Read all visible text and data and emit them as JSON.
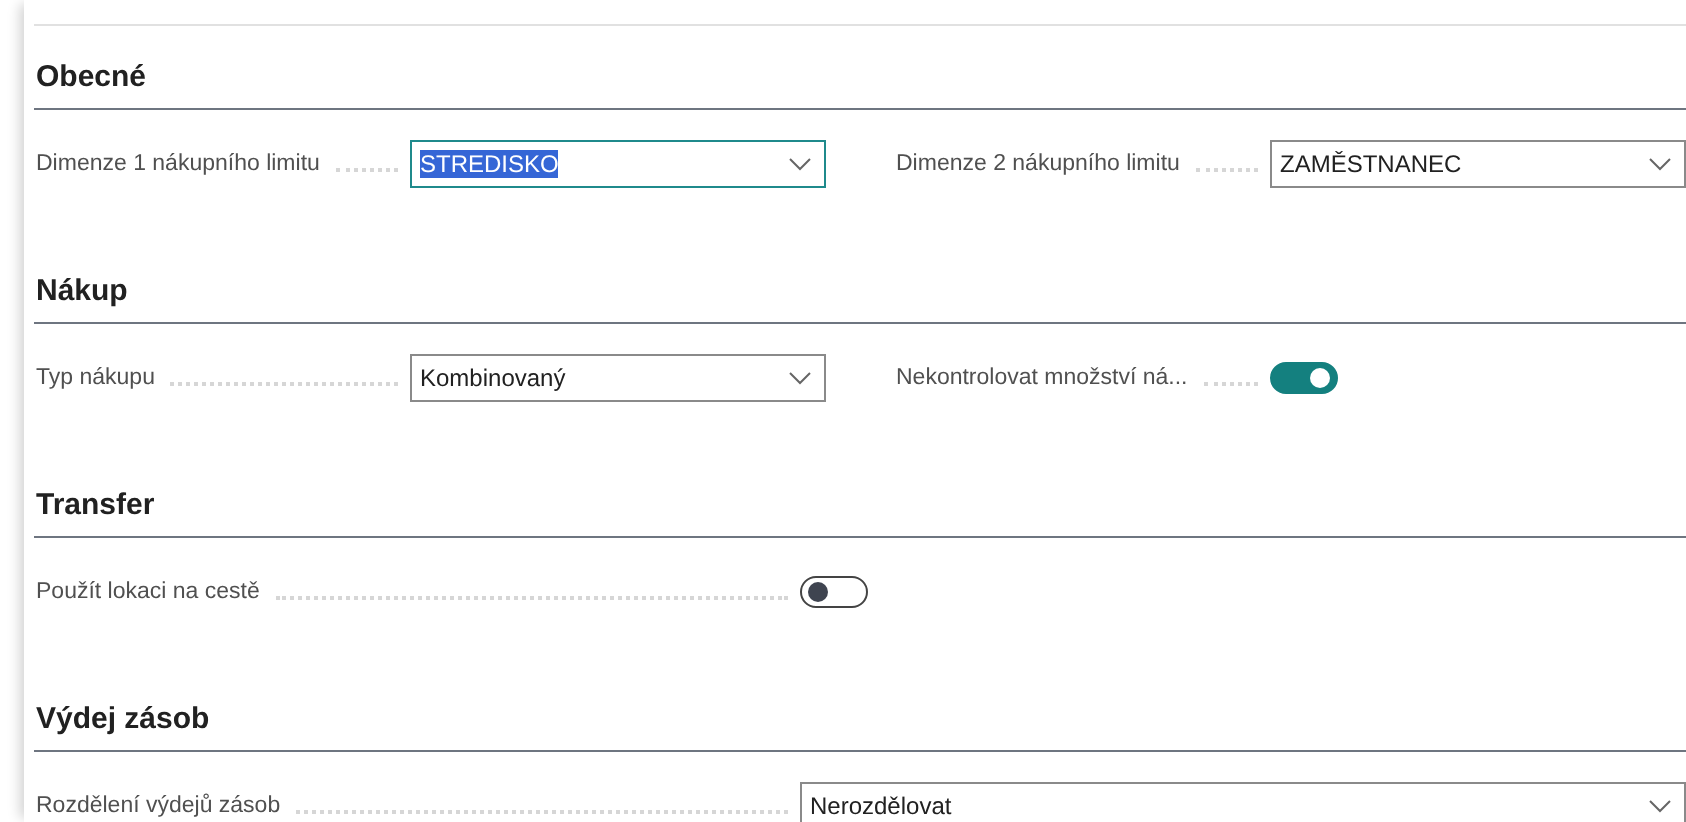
{
  "sections": [
    {
      "title": "Obecné",
      "fields": [
        {
          "kind": "select",
          "label": "Dimenze 1 nákupního limitu",
          "value": "STREDISKO",
          "focused": true
        },
        {
          "kind": "select",
          "label": "Dimenze 2 nákupního limitu",
          "value": "ZAMĚSTNANEC",
          "focused": false
        }
      ]
    },
    {
      "title": "Nákup",
      "fields": [
        {
          "kind": "select",
          "label": "Typ nákupu",
          "value": "Kombinovaný",
          "focused": false
        },
        {
          "kind": "toggle",
          "label": "Nekontrolovat množství ná...",
          "on": true
        }
      ]
    },
    {
      "title": "Transfer",
      "fields": [
        {
          "kind": "toggle",
          "label": "Použít lokaci na cestě",
          "on": false
        }
      ]
    },
    {
      "title": "Výdej zásob",
      "fields": [
        {
          "kind": "select",
          "label": "Rozdělení výdejů zásob",
          "value": "Nerozdělovat",
          "focused": false
        }
      ]
    }
  ]
}
